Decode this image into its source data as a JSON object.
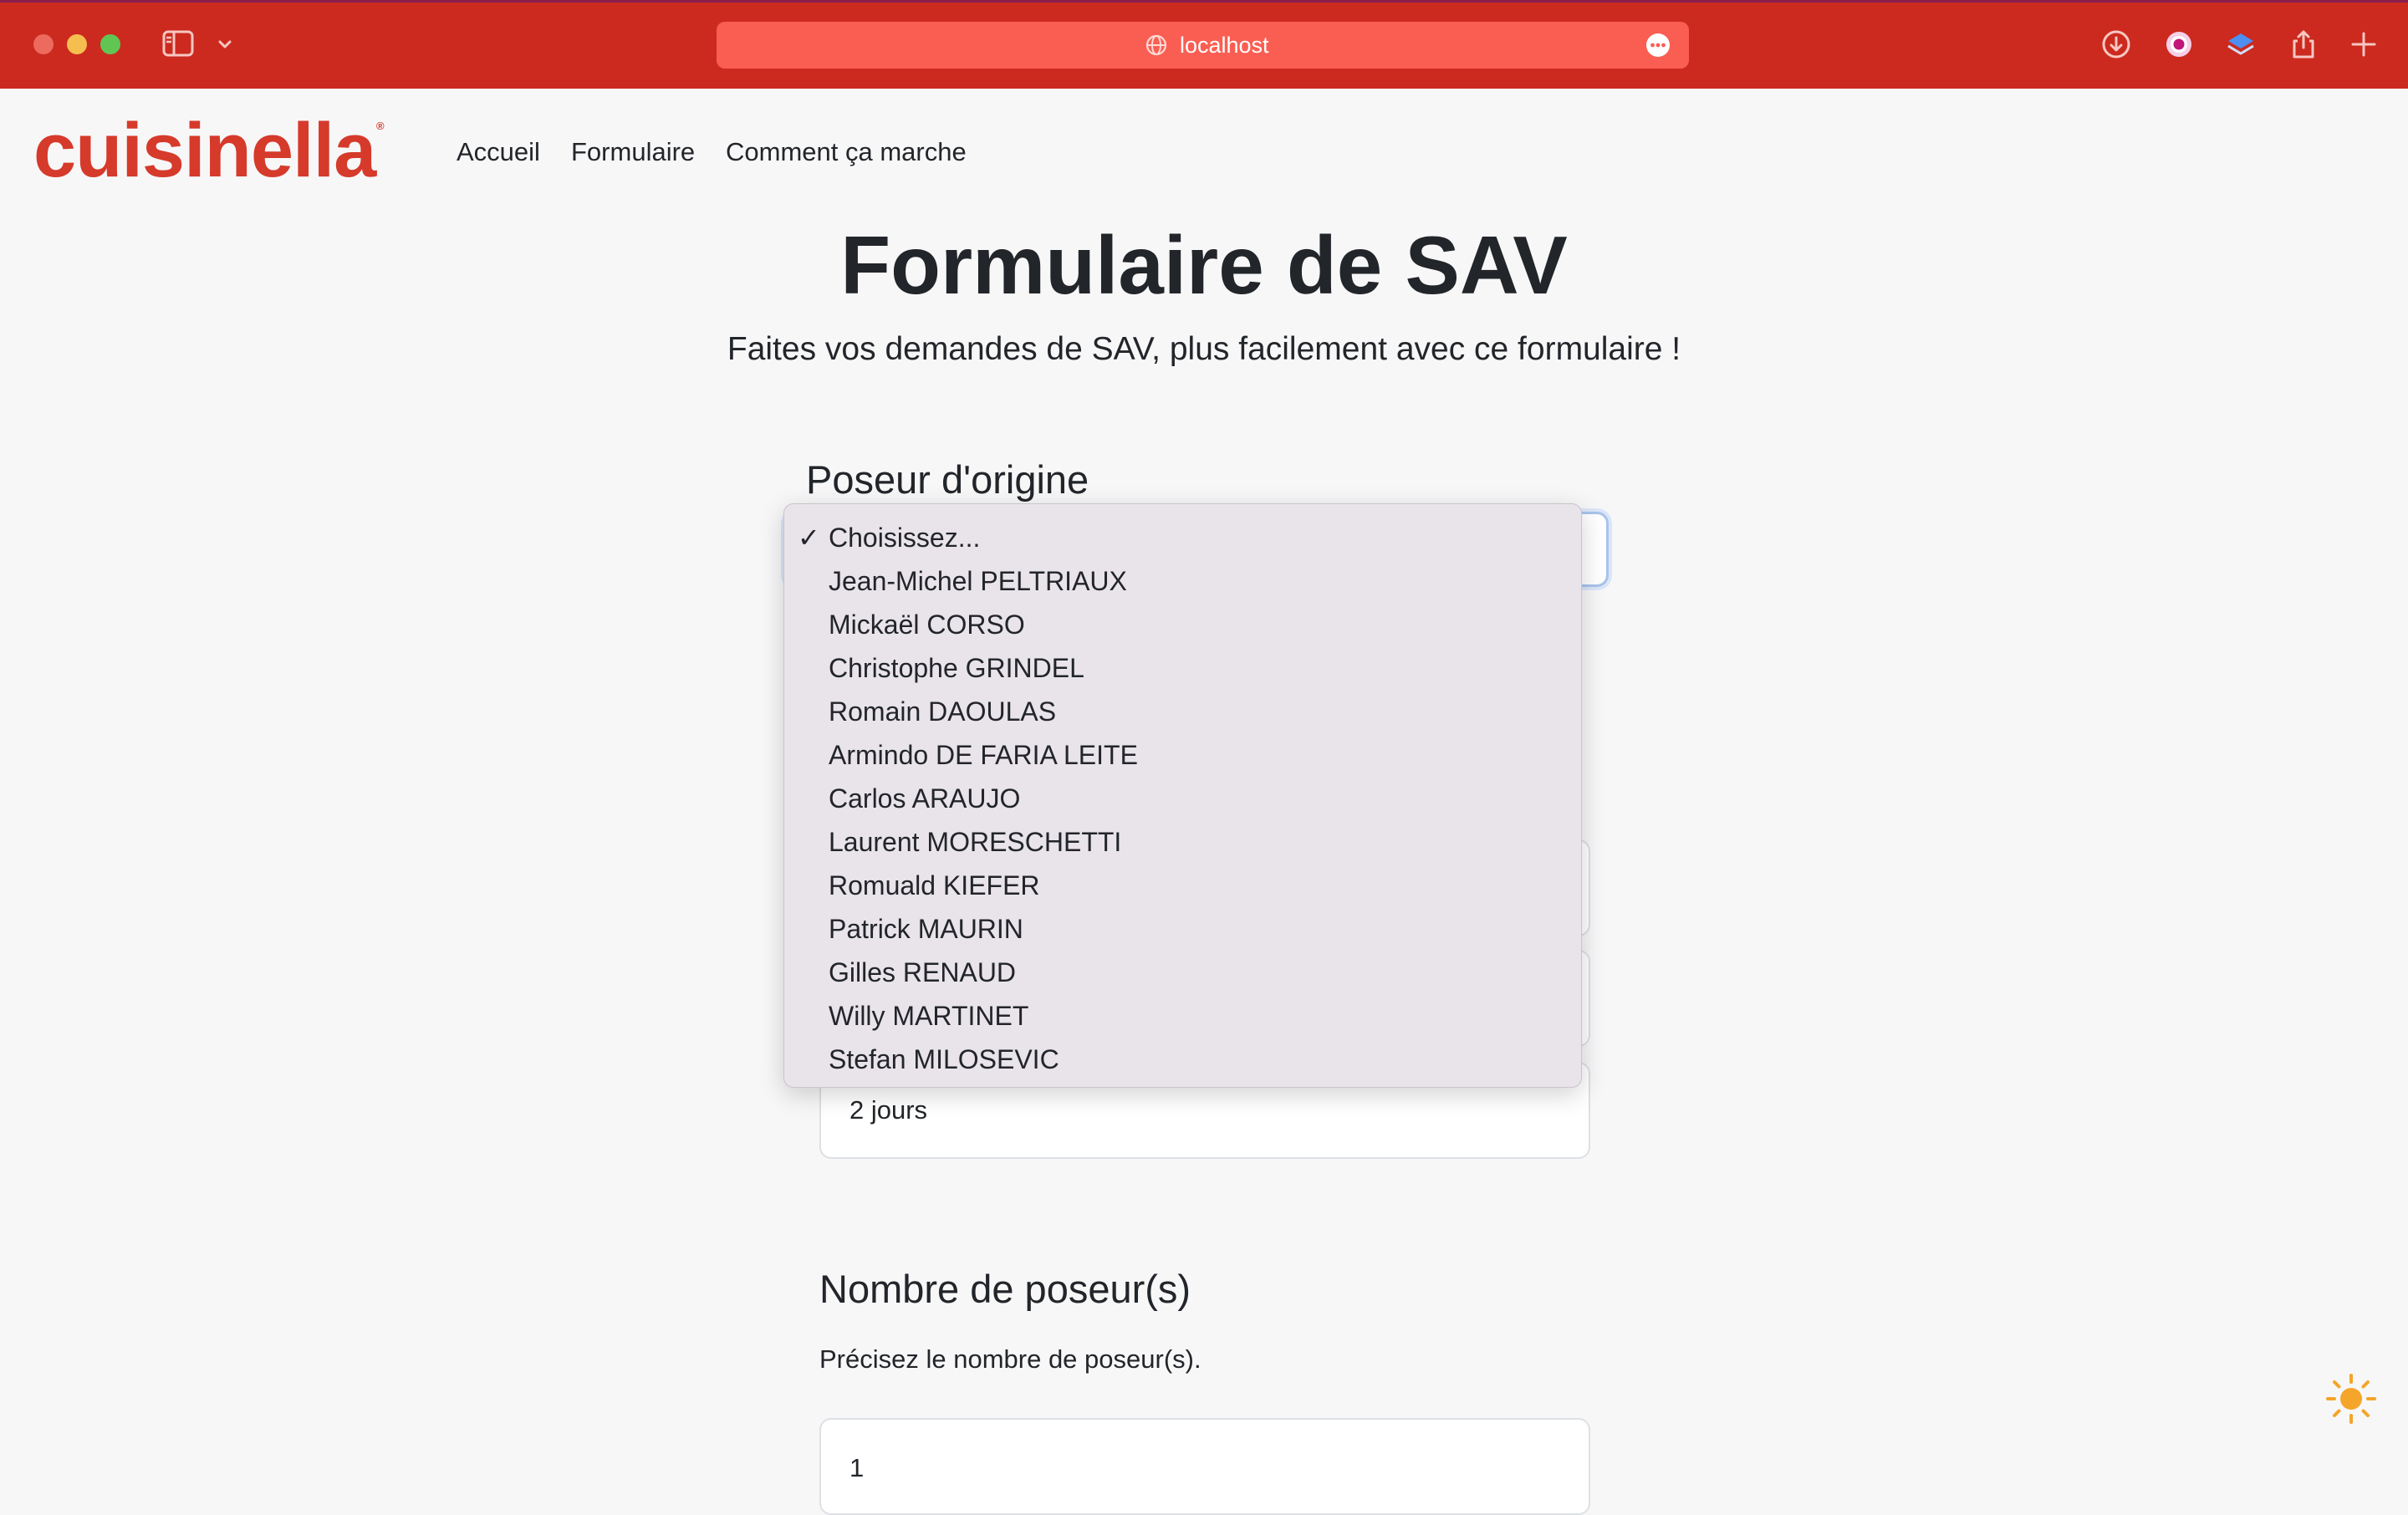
{
  "browser": {
    "url": "localhost"
  },
  "navbar": {
    "logo_text": "cuisinella",
    "logo_mark": "®",
    "links": [
      "Accueil",
      "Formulaire",
      "Comment ça marche"
    ]
  },
  "header": {
    "title": "Formulaire de SAV",
    "subtitle": "Faites vos demandes de SAV, plus facilement avec ce formulaire !"
  },
  "poseur_section": {
    "label": "Poseur d'origine",
    "selected": "Choisissez...",
    "options": [
      "Choisissez...",
      "Jean-Michel PELTRIAUX",
      "Mickaël CORSO",
      "Christophe GRINDEL",
      "Romain DAOULAS",
      "Armindo DE FARIA LEITE",
      "Carlos ARAUJO",
      "Laurent MORESCHETTI",
      "Romuald KIEFER",
      "Patrick MAURIN",
      "Gilles RENAUD",
      "Willy MARTINET",
      "Stefan MILOSEVIC"
    ],
    "check_mark": "✓"
  },
  "duration_field": {
    "value": "2 jours"
  },
  "nombre_section": {
    "label": "Nombre de poseur(s)",
    "helper": "Précisez le nombre de poseur(s).",
    "value": "1"
  },
  "colors": {
    "chrome": "#cc2a1f",
    "urlbar": "#fa5e52",
    "brand": "#d63a2b",
    "sun": "#f4a52a"
  },
  "icons": {
    "theme_toggle": "sun-icon"
  }
}
